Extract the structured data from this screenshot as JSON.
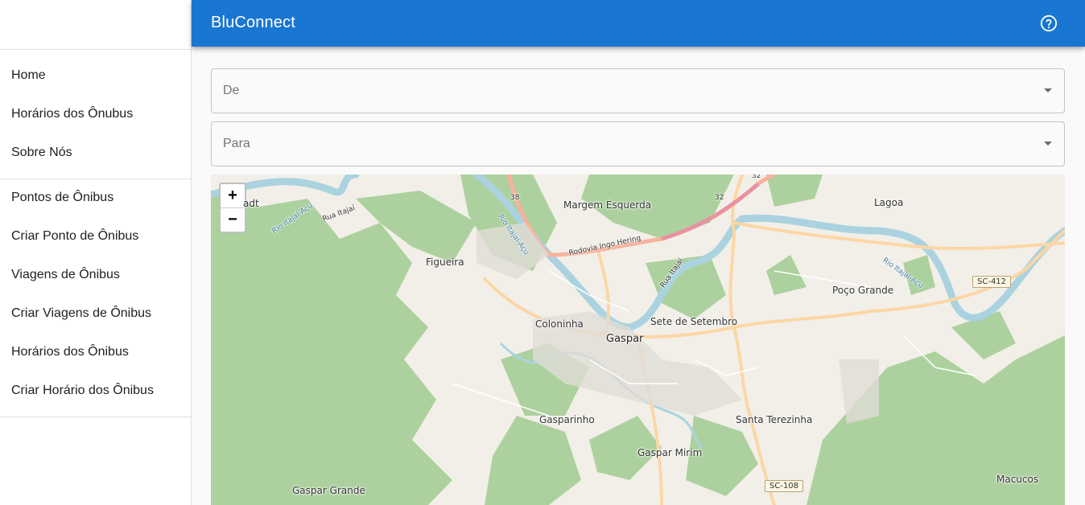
{
  "app": {
    "title": "BluConnect",
    "help_icon": "help-circle-icon",
    "accent": "#1976d2"
  },
  "sidebar": {
    "primary": [
      {
        "label": "Home"
      },
      {
        "label": "Horários dos Ônubus"
      },
      {
        "label": "Sobre Nós"
      }
    ],
    "admin": [
      {
        "label": "Pontos de Ônibus"
      },
      {
        "label": "Criar Ponto de Ônibus"
      },
      {
        "label": "Viagens de Ônibus"
      },
      {
        "label": "Criar Viagens de Ônibus"
      },
      {
        "label": "Horários dos Ônibus"
      },
      {
        "label": "Criar Horário dos Ônibus"
      }
    ]
  },
  "form": {
    "from": {
      "placeholder": "De",
      "value": ""
    },
    "to": {
      "placeholder": "Para",
      "value": ""
    }
  },
  "map": {
    "zoom_in": "+",
    "zoom_out": "−",
    "places": {
      "margem_esquerda": "Margem Esquerda",
      "lagoa": "Lagoa",
      "figueira": "Figueira",
      "poco_grande": "Poço Grande",
      "coloninha": "Coloninha",
      "sete_de_setembro": "Sete de Setembro",
      "gaspar": "Gaspar",
      "gasparinho": "Gasparinho",
      "santa_terezinha": "Santa Terezinha",
      "gaspar_mirim": "Gaspar Mirim",
      "gaspar_grande": "Gaspar Grande",
      "macucos": "Macucos",
      "adt": "adt"
    },
    "roads": {
      "rua_itajai_1": "Rua Itajaí",
      "rua_itajai_2": "Rua Itajaí",
      "rodovia": "Rodovia Ingo Hering",
      "rio_1": "Rio Itajaí-Açu",
      "rio_2": "Rio Itajaí-Açu",
      "rio_3": "Rio Itajaí-Açu",
      "sc412": "SC-412",
      "sc108": "SC-108",
      "n38": "38",
      "n32a": "32",
      "n32b": "32"
    },
    "colors": {
      "land": "#f2efe9",
      "forest": "#add19e",
      "water": "#aad3df",
      "primary_road": "#fcd6a4",
      "trunk": "#f9b29c",
      "motorway": "#e892a2"
    }
  }
}
